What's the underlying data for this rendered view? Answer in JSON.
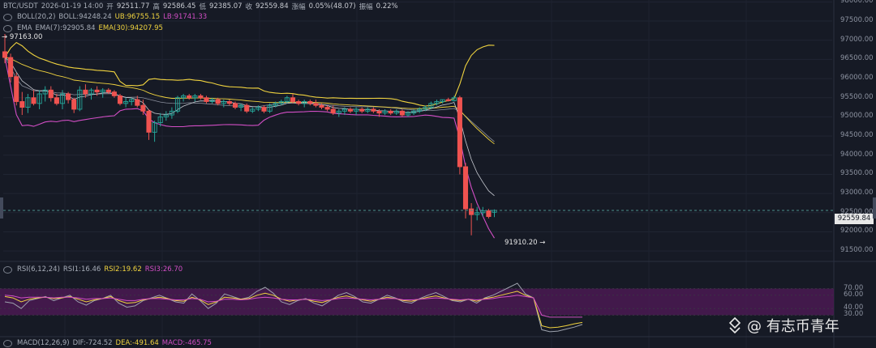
{
  "header": {
    "symbol": "BTC/USDT",
    "datetime": "2026-01-19 14:00",
    "open_label": "开",
    "open": "92511.77",
    "high_label": "高",
    "high": "92586.45",
    "low_label": "低",
    "low": "92385.07",
    "close_label": "收",
    "close": "92559.84",
    "change_label": "涨幅",
    "change": "0.05%(48.07)",
    "amp_label": "振幅",
    "amp": "0.22%"
  },
  "boll": {
    "label": "BOLL(20,2)",
    "mid": "BOLL:94248.24",
    "ub": "UB:96755.15",
    "lb": "LB:91741.33"
  },
  "ema": {
    "label": "EMA",
    "ema7": "EMA(7):92905.84",
    "ema30": "EMA(30):94207.95"
  },
  "rsi": {
    "label": "RSI(6,12,24)",
    "rsi1": "RSI1:16.46",
    "rsi2": "RSI2:19.62",
    "rsi3": "RSI3:26.70"
  },
  "macd": {
    "label": "MACD(12,26,9)",
    "dif": "DIF:-724.52",
    "dea": "DEA:-491.64",
    "macd": "MACD:-465.75"
  },
  "annotations": {
    "high_mark": "97163.00",
    "low_mark": "91910.20"
  },
  "last_price": "92559.84",
  "watermark": "@ 有志币青年",
  "colors": {
    "up": "#26a69a",
    "down": "#ef5350",
    "boll_ub": "#f0d33f",
    "boll_lb": "#d24ec5",
    "ema7": "#c8cbd2",
    "ema30": "#f0d33f",
    "rsi_band": "#4a1a52",
    "bg": "#161a25"
  },
  "chart_data": [
    {
      "type": "candlestick",
      "y_ticks": [
        91500,
        92000,
        92500,
        93000,
        93500,
        94000,
        94500,
        95000,
        95500,
        96000,
        96500,
        97000,
        97500,
        98000
      ],
      "ylim": [
        91250,
        98050
      ],
      "candles": [
        [
          96700,
          97163,
          96400,
          96550
        ],
        [
          96550,
          96650,
          95900,
          96050
        ],
        [
          96050,
          96150,
          95300,
          95400
        ],
        [
          95400,
          95650,
          95050,
          95250
        ],
        [
          95250,
          95600,
          95100,
          95500
        ],
        [
          95500,
          95700,
          95300,
          95350
        ],
        [
          95350,
          95700,
          95200,
          95600
        ],
        [
          95600,
          95800,
          95400,
          95700
        ],
        [
          95700,
          95800,
          95400,
          95500
        ],
        [
          95500,
          95600,
          95300,
          95350
        ],
        [
          95350,
          95700,
          95200,
          95600
        ],
        [
          95600,
          95650,
          95350,
          95450
        ],
        [
          95450,
          95500,
          95100,
          95200
        ],
        [
          95200,
          95800,
          95150,
          95700
        ],
        [
          95700,
          95850,
          95500,
          95600
        ],
        [
          95600,
          95750,
          95450,
          95700
        ],
        [
          95700,
          95800,
          95550,
          95650
        ],
        [
          95650,
          95750,
          95500,
          95700
        ],
        [
          95700,
          95750,
          95600,
          95650
        ],
        [
          95650,
          95700,
          95500,
          95550
        ],
        [
          95550,
          95600,
          95300,
          95350
        ],
        [
          95350,
          95500,
          95250,
          95400
        ],
        [
          95400,
          95500,
          95300,
          95450
        ],
        [
          95450,
          95550,
          95250,
          95300
        ],
        [
          95300,
          95450,
          95050,
          95150
        ],
        [
          95150,
          95200,
          94400,
          94600
        ],
        [
          94600,
          94900,
          94350,
          94850
        ],
        [
          94850,
          95100,
          94750,
          95000
        ],
        [
          95000,
          95150,
          94900,
          95050
        ],
        [
          95050,
          95250,
          94950,
          95150
        ],
        [
          95150,
          95550,
          95100,
          95500
        ],
        [
          95500,
          95600,
          95400,
          95550
        ],
        [
          95550,
          95600,
          95450,
          95500
        ],
        [
          95500,
          95600,
          95400,
          95550
        ],
        [
          95550,
          95600,
          95450,
          95500
        ],
        [
          95500,
          95550,
          95350,
          95400
        ],
        [
          95400,
          95500,
          95350,
          95450
        ],
        [
          95450,
          95500,
          95300,
          95350
        ],
        [
          95350,
          95450,
          95250,
          95400
        ],
        [
          95400,
          95450,
          95300,
          95350
        ],
        [
          95350,
          95400,
          95200,
          95250
        ],
        [
          95250,
          95350,
          95150,
          95300
        ],
        [
          95300,
          95350,
          95100,
          95150
        ],
        [
          95150,
          95250,
          95100,
          95200
        ],
        [
          95200,
          95300,
          95150,
          95250
        ],
        [
          95250,
          95300,
          95100,
          95150
        ],
        [
          95150,
          95350,
          95100,
          95300
        ],
        [
          95300,
          95400,
          95250,
          95350
        ],
        [
          95350,
          95450,
          95300,
          95400
        ],
        [
          95400,
          95550,
          95350,
          95500
        ],
        [
          95500,
          95600,
          95350,
          95400
        ],
        [
          95400,
          95450,
          95300,
          95350
        ],
        [
          95350,
          95450,
          95250,
          95400
        ],
        [
          95400,
          95450,
          95300,
          95350
        ],
        [
          95350,
          95450,
          95250,
          95300
        ],
        [
          95300,
          95350,
          95200,
          95250
        ],
        [
          95250,
          95300,
          95150,
          95200
        ],
        [
          95200,
          95300,
          95050,
          95100
        ],
        [
          95100,
          95200,
          95000,
          95150
        ],
        [
          95150,
          95250,
          95050,
          95200
        ],
        [
          95200,
          95250,
          95100,
          95150
        ],
        [
          95150,
          95250,
          95050,
          95200
        ],
        [
          95200,
          95250,
          95100,
          95150
        ],
        [
          95150,
          95250,
          95100,
          95200
        ],
        [
          95200,
          95250,
          95100,
          95150
        ],
        [
          95150,
          95200,
          95000,
          95100
        ],
        [
          95100,
          95200,
          95050,
          95150
        ],
        [
          95150,
          95200,
          95050,
          95100
        ],
        [
          95100,
          95200,
          95050,
          95150
        ],
        [
          95150,
          95200,
          95000,
          95050
        ],
        [
          95050,
          95150,
          95000,
          95100
        ],
        [
          95100,
          95200,
          95050,
          95150
        ],
        [
          95150,
          95250,
          95100,
          95200
        ],
        [
          95200,
          95300,
          95150,
          95250
        ],
        [
          95250,
          95400,
          95200,
          95350
        ],
        [
          95350,
          95450,
          95300,
          95400
        ],
        [
          95400,
          95450,
          95350,
          95450
        ],
        [
          95450,
          95500,
          95400,
          95420
        ],
        [
          95420,
          95550,
          95400,
          95500
        ],
        [
          95500,
          95550,
          93500,
          93700
        ],
        [
          93700,
          93800,
          92350,
          92600
        ],
        [
          92600,
          92750,
          91910,
          92450
        ],
        [
          92450,
          92650,
          92300,
          92500
        ],
        [
          92500,
          92650,
          92400,
          92550
        ],
        [
          92550,
          92600,
          92350,
          92400
        ],
        [
          92511,
          92586,
          92385,
          92560
        ]
      ]
    },
    {
      "type": "line",
      "series": [
        {
          "name": "RSI1",
          "values": [
            50,
            48,
            40,
            52,
            55,
            58,
            52,
            56,
            60,
            50,
            45,
            52,
            55,
            60,
            48,
            42,
            44,
            52,
            56,
            60,
            55,
            50,
            48,
            62,
            52,
            40,
            48,
            62,
            58,
            54,
            57,
            66,
            72,
            63,
            50,
            46,
            52,
            55,
            48,
            44,
            52,
            60,
            64,
            58,
            50,
            48,
            54,
            60,
            56,
            50,
            48,
            55,
            60,
            64,
            58,
            52,
            50,
            54,
            48,
            56,
            60,
            66,
            72,
            78,
            62,
            56,
            8,
            5,
            6,
            9,
            12,
            16
          ]
        },
        {
          "name": "RSI2",
          "values": [
            58,
            56,
            50,
            54,
            56,
            57,
            55,
            56,
            58,
            54,
            50,
            53,
            55,
            58,
            52,
            48,
            49,
            53,
            55,
            57,
            55,
            52,
            51,
            57,
            53,
            46,
            50,
            57,
            56,
            54,
            55,
            60,
            63,
            60,
            54,
            51,
            53,
            54,
            51,
            49,
            53,
            57,
            59,
            56,
            53,
            51,
            54,
            57,
            55,
            52,
            51,
            54,
            57,
            59,
            56,
            53,
            52,
            54,
            51,
            55,
            57,
            60,
            63,
            66,
            60,
            56,
            14,
            11,
            12,
            14,
            17,
            19
          ]
        },
        {
          "name": "RSI3",
          "values": [
            60,
            59,
            56,
            57,
            57,
            57,
            56,
            57,
            57,
            56,
            54,
            55,
            55,
            56,
            54,
            52,
            52,
            54,
            55,
            55,
            54,
            53,
            53,
            55,
            54,
            50,
            51,
            54,
            54,
            53,
            54,
            56,
            57,
            56,
            54,
            53,
            53,
            54,
            53,
            52,
            53,
            55,
            56,
            55,
            54,
            53,
            54,
            55,
            55,
            53,
            53,
            54,
            55,
            56,
            55,
            54,
            53,
            54,
            53,
            54,
            55,
            57,
            58,
            60,
            58,
            56,
            30,
            27,
            27,
            27,
            27,
            27
          ]
        }
      ],
      "y_ticks": [
        30,
        40,
        60,
        70
      ],
      "band": [
        30,
        70
      ]
    }
  ]
}
